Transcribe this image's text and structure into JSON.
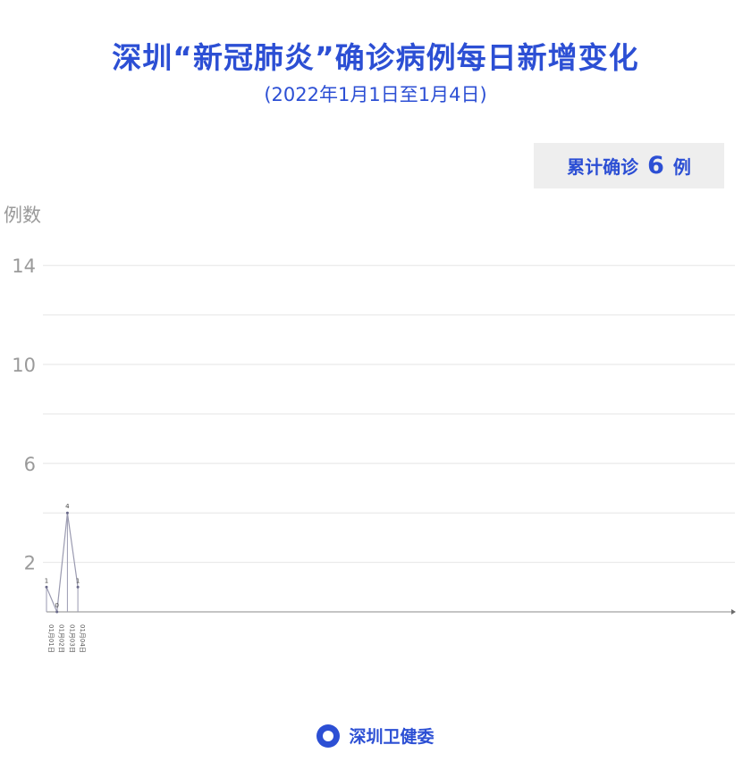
{
  "header": {
    "title": "深圳“新冠肺炎”确诊病例每日新增变化",
    "subtitle": "(2022年1月1日至1月4日)"
  },
  "summary": {
    "prefix": "累计确诊",
    "count": "6",
    "suffix": "例"
  },
  "footer": {
    "org": "深圳卫健委",
    "logo_icon": "health-commission-logo-icon"
  },
  "colors": {
    "accent": "#2c4fd4",
    "line": "#9a9ab0",
    "grid": "#e6e6e6"
  },
  "chart_data": {
    "type": "line",
    "title": "深圳“新冠肺炎”确诊病例每日新增变化",
    "ylabel": "例数",
    "xlabel": "",
    "yticks": [
      2,
      6,
      10,
      14
    ],
    "ylim": [
      0,
      14
    ],
    "grid": true,
    "categories": [
      "01月01日",
      "01月02日",
      "01月03日",
      "01月04日"
    ],
    "values": [
      1,
      0,
      4,
      1
    ]
  }
}
